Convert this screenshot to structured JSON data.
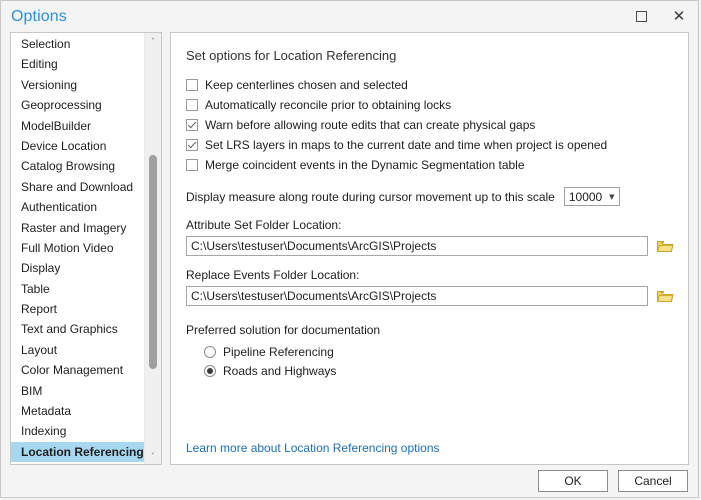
{
  "window": {
    "title": "Options",
    "maximize_tooltip": "Maximize",
    "close_tooltip": "Close"
  },
  "sidebar": {
    "items": [
      {
        "label": "Selection",
        "selected": false
      },
      {
        "label": "Editing",
        "selected": false
      },
      {
        "label": "Versioning",
        "selected": false
      },
      {
        "label": "Geoprocessing",
        "selected": false
      },
      {
        "label": "ModelBuilder",
        "selected": false
      },
      {
        "label": "Device Location",
        "selected": false
      },
      {
        "label": "Catalog Browsing",
        "selected": false
      },
      {
        "label": "Share and Download",
        "selected": false
      },
      {
        "label": "Authentication",
        "selected": false
      },
      {
        "label": "Raster and Imagery",
        "selected": false
      },
      {
        "label": "Full Motion Video",
        "selected": false
      },
      {
        "label": "Display",
        "selected": false
      },
      {
        "label": "Table",
        "selected": false
      },
      {
        "label": "Report",
        "selected": false
      },
      {
        "label": "Text and Graphics",
        "selected": false
      },
      {
        "label": "Layout",
        "selected": false
      },
      {
        "label": "Color Management",
        "selected": false
      },
      {
        "label": "BIM",
        "selected": false
      },
      {
        "label": "Metadata",
        "selected": false
      },
      {
        "label": "Indexing",
        "selected": false
      },
      {
        "label": "Location Referencing",
        "selected": true
      }
    ],
    "scroll_up_glyph": "˄",
    "scroll_down_glyph": "˅"
  },
  "main": {
    "heading": "Set options for Location Referencing",
    "checkboxes": [
      {
        "label": "Keep centerlines chosen and selected",
        "checked": false
      },
      {
        "label": "Automatically reconcile prior to obtaining locks",
        "checked": false
      },
      {
        "label": "Warn before allowing route edits that can create physical gaps",
        "checked": true
      },
      {
        "label": "Set LRS layers in maps to the current date and time when project is opened",
        "checked": true
      },
      {
        "label": "Merge coincident events in the Dynamic Segmentation table",
        "checked": false
      }
    ],
    "scale": {
      "label": "Display measure along route during cursor movement up to this scale",
      "value": "10000",
      "options": [
        "10000"
      ]
    },
    "attribute_set_folder": {
      "label": "Attribute Set Folder Location:",
      "value": "C:\\Users\\testuser\\Documents\\ArcGIS\\Projects",
      "placeholder": ""
    },
    "replace_events_folder": {
      "label": "Replace Events Folder Location:",
      "value": "C:\\Users\\testuser\\Documents\\ArcGIS\\Projects",
      "placeholder": ""
    },
    "preferred_solution": {
      "label": "Preferred solution for documentation",
      "options": [
        {
          "label": "Pipeline Referencing",
          "selected": false
        },
        {
          "label": "Roads and Highways",
          "selected": true
        }
      ]
    },
    "learn_more_link": "Learn more about Location Referencing options"
  },
  "footer": {
    "ok_label": "OK",
    "cancel_label": "Cancel"
  },
  "colors": {
    "title_blue": "#2f8fd4",
    "selection_blue": "#a8d8f0",
    "link_blue": "#1d6fb5",
    "folder_gold": "#e8c54d",
    "dialog_bg": "#f4f4f4"
  }
}
